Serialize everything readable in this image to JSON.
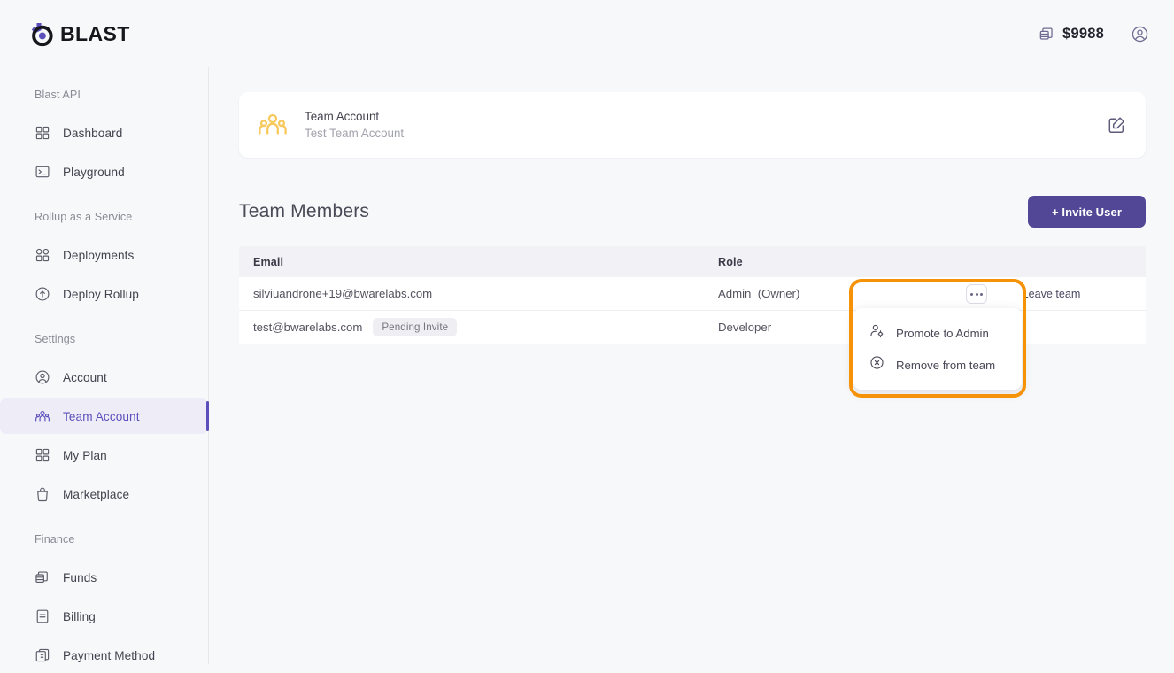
{
  "brand": {
    "name": "BLAST",
    "logo_icon": "blast-logo-icon",
    "accent": "#5b4fbb",
    "logo_dark": "#17161c"
  },
  "topbar": {
    "balance_icon": "coins-stack-icon",
    "balance": "$9988",
    "account_icon": "user-circle-icon"
  },
  "sidebar": {
    "groups": [
      {
        "title": "Blast API",
        "items": [
          {
            "label": "Dashboard",
            "icon": "grid-squares-icon",
            "active": false
          },
          {
            "label": "Playground",
            "icon": "terminal-icon",
            "active": false
          }
        ]
      },
      {
        "title": "Rollup as a Service",
        "items": [
          {
            "label": "Deployments",
            "icon": "grid-dots-icon",
            "active": false
          },
          {
            "label": "Deploy Rollup",
            "icon": "circle-arrow-up-icon",
            "active": false
          }
        ]
      },
      {
        "title": "Settings",
        "items": [
          {
            "label": "Account",
            "icon": "user-circle-icon",
            "active": false
          },
          {
            "label": "Team Account",
            "icon": "team-group-icon",
            "active": true
          },
          {
            "label": "My Plan",
            "icon": "grid-squares-icon",
            "active": false
          },
          {
            "label": "Marketplace",
            "icon": "bag-icon",
            "active": false
          }
        ]
      },
      {
        "title": "Finance",
        "items": [
          {
            "label": "Funds",
            "icon": "coins-stack-icon",
            "active": false
          },
          {
            "label": "Billing",
            "icon": "invoice-icon",
            "active": false
          },
          {
            "label": "Payment Method",
            "icon": "payment-card-icon",
            "active": false
          }
        ]
      }
    ]
  },
  "main": {
    "team_card": {
      "icon": "team-group-icon",
      "icon_color": "#f7c85c",
      "title": "Team Account",
      "subtitle": "Test Team Account",
      "edit_icon": "edit-square-icon"
    },
    "section": {
      "title": "Team Members",
      "invite_label": "+ Invite User",
      "invite_color": "#524796"
    },
    "table": {
      "columns": [
        "Email",
        "Role"
      ],
      "rows": [
        {
          "email": "silviuandrone+19@bwarelabs.com",
          "badge": "",
          "role": "Admin",
          "role_suffix": "(Owner)",
          "action": "Leave team",
          "has_menu": false
        },
        {
          "email": "test@bwarelabs.com",
          "badge": "Pending Invite",
          "role": "Developer",
          "role_suffix": "",
          "action": "",
          "has_menu": true
        }
      ]
    },
    "menu": {
      "trigger_icon": "ellipsis-icon",
      "items": [
        {
          "label": "Promote to Admin",
          "icon": "user-gear-icon"
        },
        {
          "label": "Remove from team",
          "icon": "circle-x-icon"
        }
      ],
      "highlight_color": "#f59208"
    }
  }
}
